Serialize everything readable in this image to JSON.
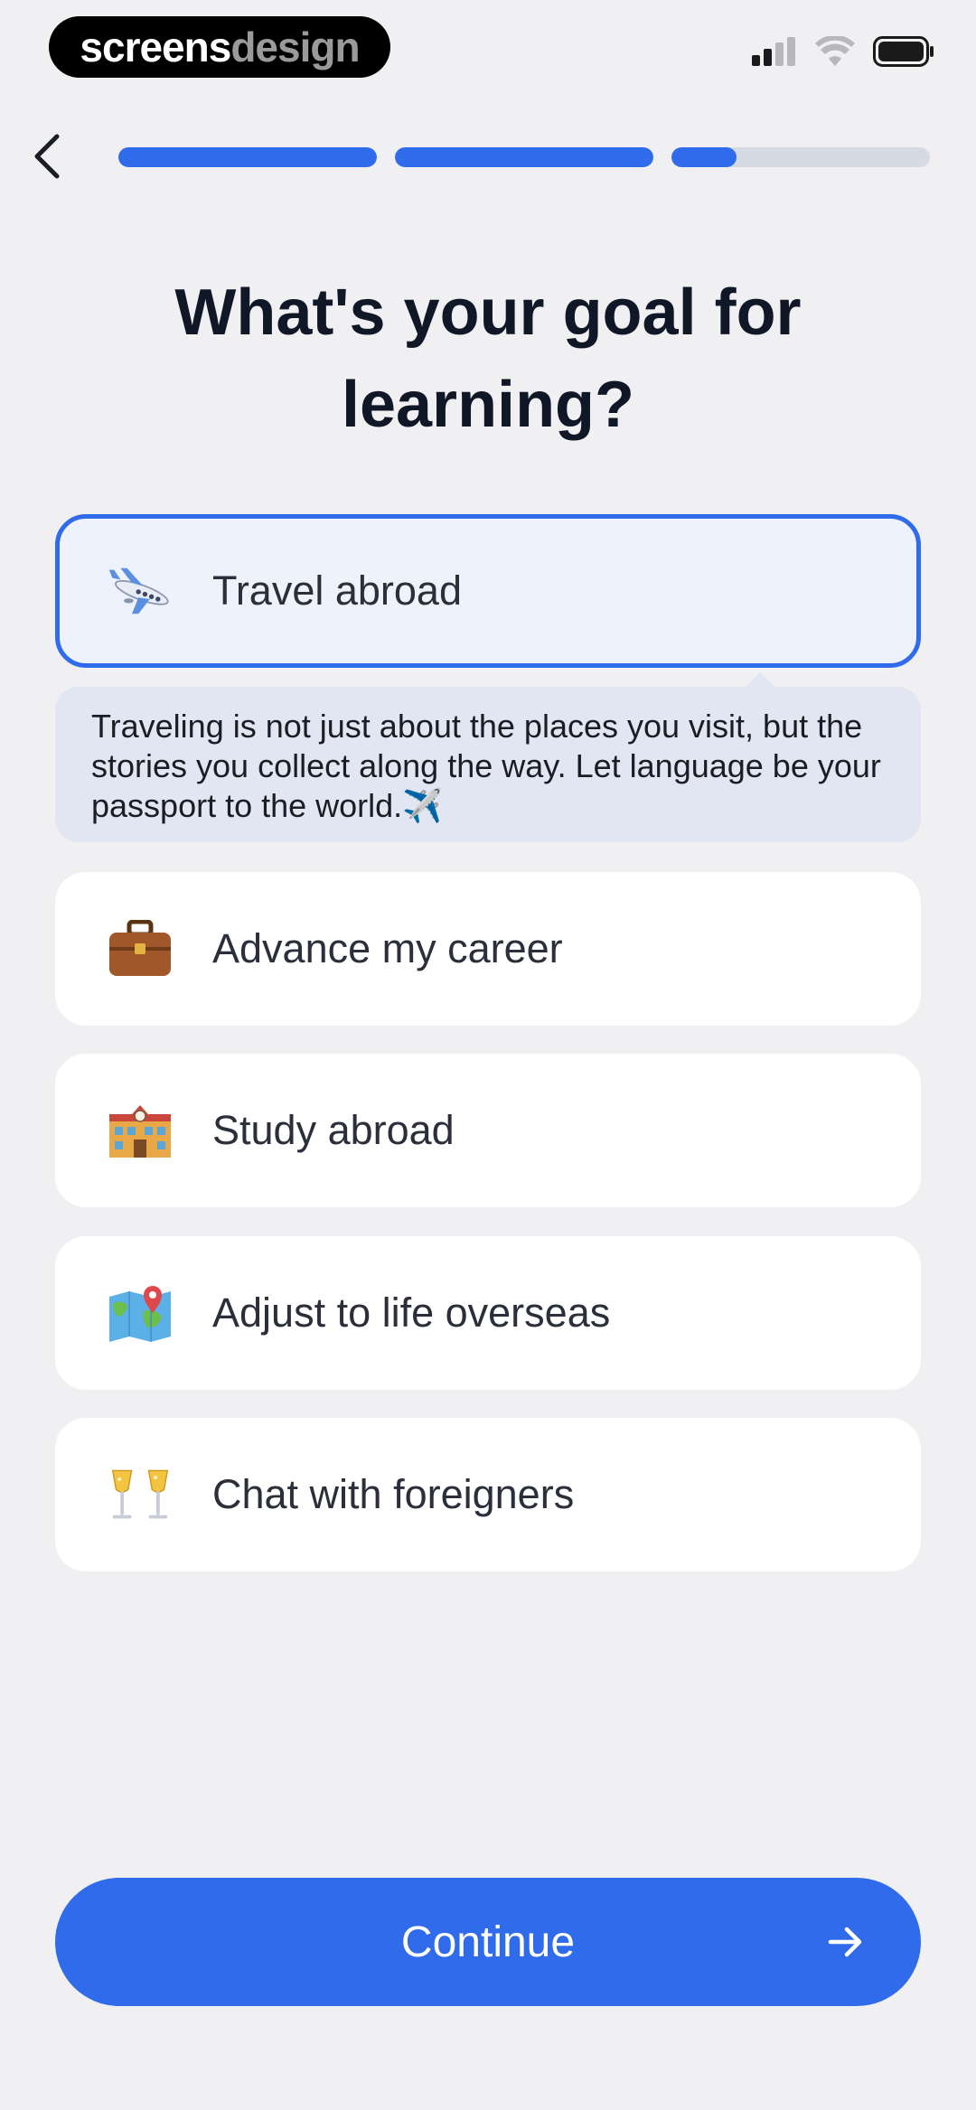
{
  "status_bar": {
    "brand_part1": "screens",
    "brand_part2": "design"
  },
  "progress": {
    "steps": [
      {
        "fill": 1.0
      },
      {
        "fill": 1.0
      },
      {
        "fill": 0.25
      }
    ]
  },
  "title": "What's your goal for learning?",
  "options": [
    {
      "label": "Travel abroad",
      "icon": "airplane-icon",
      "selected": true
    },
    {
      "label": "Advance my career",
      "icon": "briefcase-icon",
      "selected": false
    },
    {
      "label": "Study abroad",
      "icon": "school-icon",
      "selected": false
    },
    {
      "label": "Adjust to life overseas",
      "icon": "world-map-icon",
      "selected": false
    },
    {
      "label": "Chat with foreigners",
      "icon": "champagne-glasses-icon",
      "selected": false
    }
  ],
  "tip": {
    "text": "Traveling is not just about the places you visit, but the stories you collect along the way. Let language be your passport to the world.✈️"
  },
  "continue_button": {
    "label": "Continue"
  },
  "colors": {
    "accent": "#2f6bea",
    "background": "#f0f0f2",
    "selected_bg": "#eef2fd",
    "tip_bg": "#e2e6f2",
    "title": "#101828"
  }
}
